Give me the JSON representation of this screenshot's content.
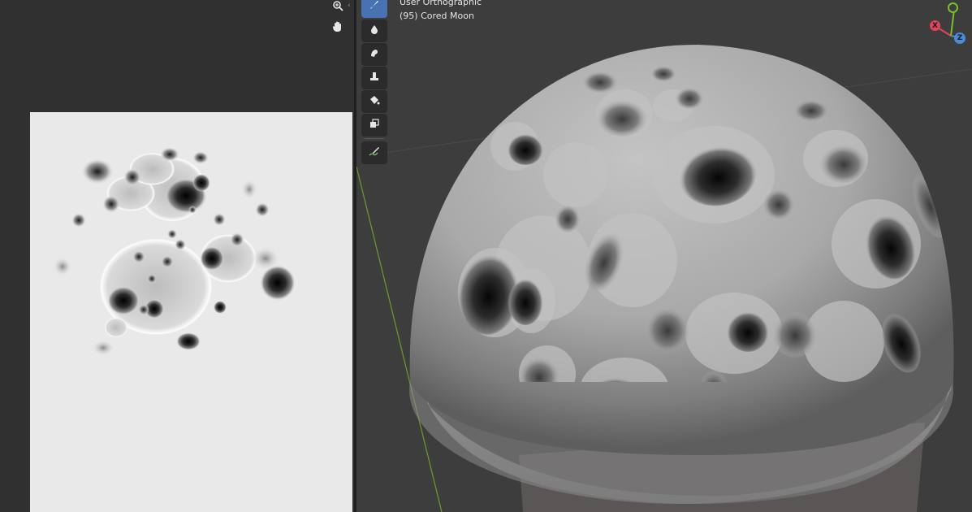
{
  "viewport": {
    "view_mode": "User Orthographic",
    "object_label": "(95) Cored Moon",
    "gizmo": {
      "x_label": "X",
      "z_label": "Z"
    }
  },
  "toolbar": {
    "tools": [
      {
        "name": "draw-tool",
        "icon": "brush-icon",
        "active": true
      },
      {
        "name": "soften-tool",
        "icon": "drop-icon",
        "active": false
      },
      {
        "name": "smear-tool",
        "icon": "smear-icon",
        "active": false
      },
      {
        "name": "clone-tool",
        "icon": "stamp-icon",
        "active": false
      },
      {
        "name": "fill-tool",
        "icon": "bucket-icon",
        "active": false
      },
      {
        "name": "mask-tool",
        "icon": "mask-icon",
        "active": false
      },
      {
        "name": "annotate-tool",
        "icon": "annotate-icon",
        "active": false
      }
    ]
  },
  "image_editor": {
    "nav_icons": [
      "zoom-icon",
      "hand-pan-icon"
    ]
  },
  "colors": {
    "active_tool": "#4772b3",
    "viewport_bg": "#3d3d3d",
    "editor_bg": "#303030",
    "axis_x": "#e0455a",
    "axis_y": "#7bbf2b",
    "axis_z": "#4a8bd6",
    "y_axis_line": "#6f9a2a"
  }
}
